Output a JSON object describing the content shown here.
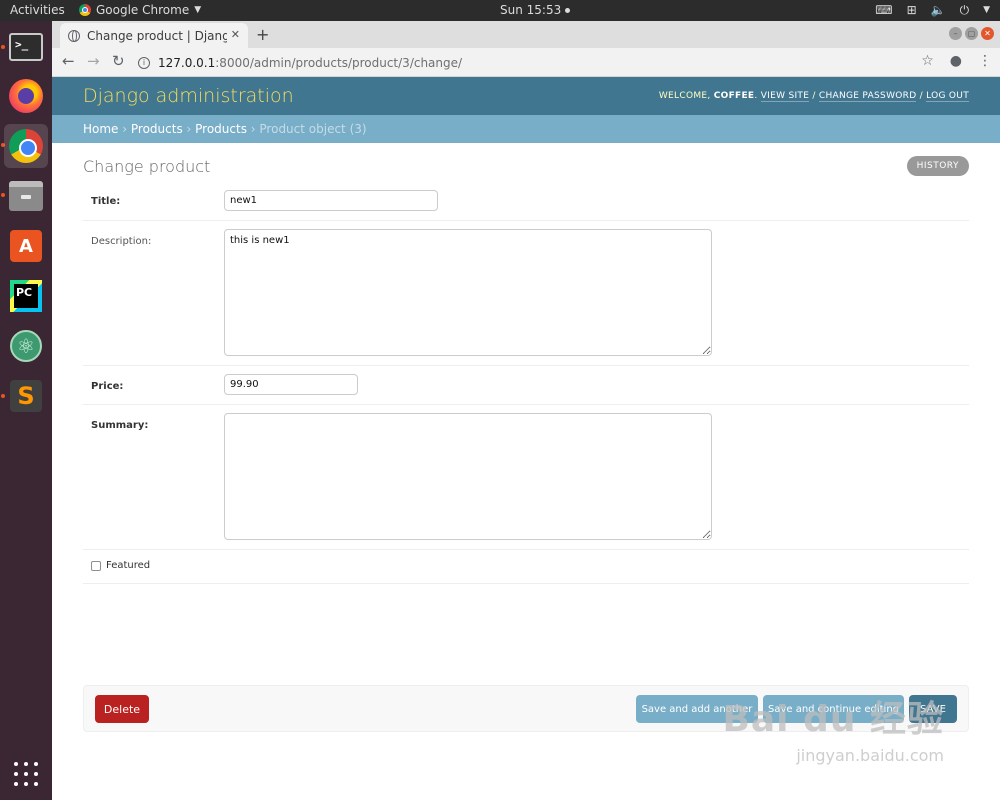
{
  "topbar": {
    "activities": "Activities",
    "app_name": "Google Chrome",
    "clock": "Sun 15:53"
  },
  "dock": {
    "items": [
      {
        "name": "terminal",
        "glyph": ">_"
      },
      {
        "name": "firefox"
      },
      {
        "name": "chrome"
      },
      {
        "name": "files"
      },
      {
        "name": "software-center",
        "glyph": "A"
      },
      {
        "name": "pycharm",
        "glyph": "PC"
      },
      {
        "name": "atom",
        "glyph": "⚛"
      },
      {
        "name": "sublime-text",
        "glyph": "S"
      }
    ]
  },
  "browser": {
    "tab_title": "Change product | Django",
    "url_host": "127.0.0.1",
    "url_path": ":8000/admin/products/product/3/change/"
  },
  "admin": {
    "brand": "Django administration",
    "welcome": "Welcome,",
    "username": "coffee",
    "links": {
      "view_site": "View site",
      "change_password": "Change password",
      "log_out": "Log out"
    },
    "breadcrumbs": {
      "home": "Home",
      "app": "Products",
      "model": "Products",
      "current": "Product object (3)"
    },
    "page_title": "Change product",
    "history_label": "HISTORY"
  },
  "form": {
    "title": {
      "label": "Title:",
      "value": "new1"
    },
    "description": {
      "label": "Description:",
      "value": "this is new1"
    },
    "price": {
      "label": "Price:",
      "value": "99.90"
    },
    "summary": {
      "label": "Summary:",
      "value": ""
    },
    "featured": {
      "label": "Featured",
      "checked": false
    }
  },
  "actions": {
    "delete": "Delete",
    "save_add_another": "Save and add another",
    "save_continue": "Save and continue editing",
    "save": "SAVE"
  },
  "watermark": {
    "main": "Bai du 经验",
    "sub": "jingyan.baidu.com"
  },
  "colors": {
    "header": "#417690",
    "breadcrumbs": "#79aec8",
    "brand_text": "#f5dd5d",
    "delete": "#ba2121",
    "dock": "#3b2633"
  }
}
